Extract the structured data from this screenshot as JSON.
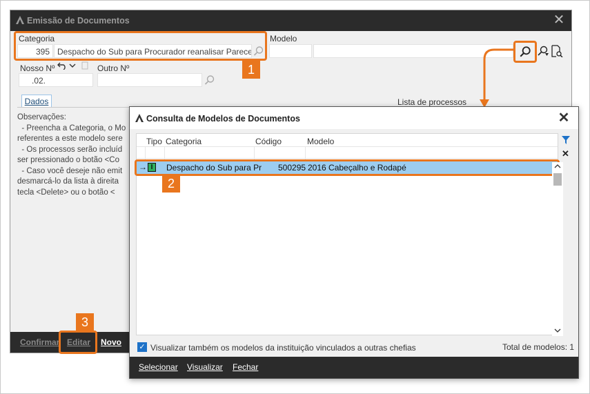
{
  "main_window": {
    "title": "Emissão de Documentos",
    "categoria_label": "Categoria",
    "categoria_code": "395",
    "categoria_value": "Despacho do Sub para Procurador reanalisar Parecer",
    "modelo_label": "Modelo",
    "modelo_value": "",
    "nosso_label": "Nosso Nº",
    "nosso_value": ".02.",
    "outro_label": "Outro Nº",
    "outro_value": "",
    "tab_dados": "Dados",
    "lista_label": "Lista de processos",
    "observacoes": "Observações:\n  - Preencha a Categoria, o Mo\nreferentes a este modelo sere\n  - Os processos serão incluíd\nser pressionado o botão <Co\n  - Caso você deseje não emit\ndesmarcá-lo da lista à direita\ntecla <Delete> ou o botão <",
    "footer": {
      "confirmar": "Confirmar",
      "editar": "Editar",
      "novo": "Novo"
    }
  },
  "dialog": {
    "title": "Consulta de Modelos de Documentos",
    "columns": [
      "Tipo",
      "Categoria",
      "Código",
      "Modelo"
    ],
    "rows": [
      {
        "tipo": "I",
        "categoria": "Despacho do Sub para Pr",
        "codigo": "500295",
        "modelo": "2016 Cabeçalho e Rodapé"
      }
    ],
    "checkbox_label": "Visualizar também os modelos da instituição vinculados a outras chefias",
    "checkbox_checked": true,
    "total_label": "Total de modelos: 1",
    "footer": {
      "selecionar": "Selecionar",
      "visualizar": "Visualizar",
      "fechar": "Fechar"
    }
  },
  "callouts": [
    "1",
    "2",
    "3"
  ],
  "colors": {
    "accent": "#e9761e",
    "title_bar": "#2b2b2b",
    "row_selected": "#9ccdf0",
    "checkbox": "#1e72c8",
    "tipo_badge": "#2fae5e"
  }
}
